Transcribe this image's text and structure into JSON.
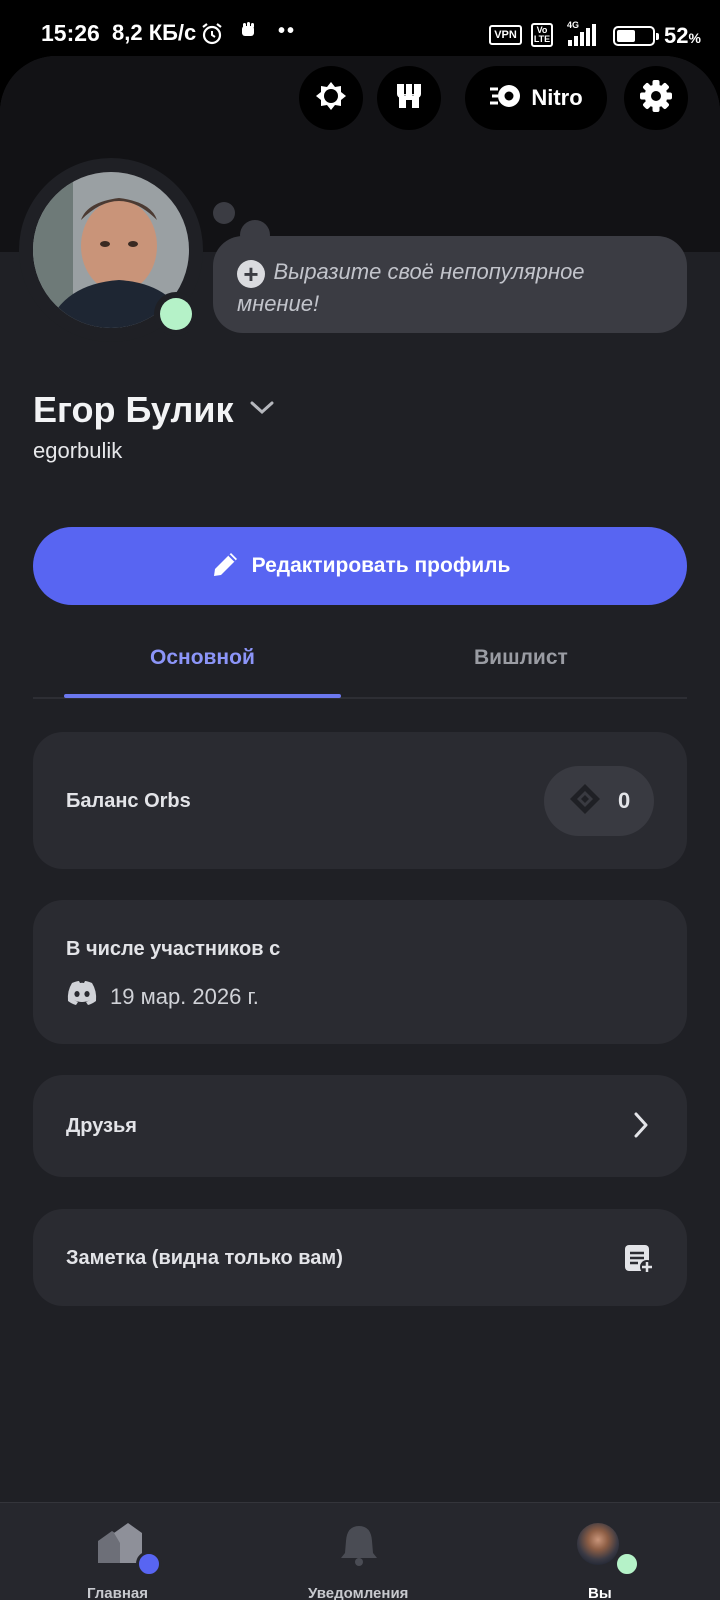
{
  "status_bar": {
    "time": "15:26",
    "speed": "8,2 КБ/с",
    "extra_dots": "••",
    "vpn": "VPN",
    "volte_top": "Vo",
    "volte_bottom": "LTE",
    "network": "4G",
    "battery_value": "52",
    "battery_unit": "%",
    "battery_level": 0.52
  },
  "header": {
    "nitro_label": "Nitro",
    "icons": [
      "quests-icon",
      "shop-icon",
      "nitro-icon",
      "settings-icon"
    ]
  },
  "profile": {
    "display_name": "Егор Булик",
    "username": "egorbulik",
    "status_color": "#b5f2c8",
    "bubble_placeholder": "Выразите своё непопулярное мнение!"
  },
  "edit_button": {
    "label": "Редактировать профиль"
  },
  "tabs": [
    {
      "label": "Основной",
      "active": true
    },
    {
      "label": "Вишлист",
      "active": false
    }
  ],
  "orbs": {
    "label": "Баланс Orbs",
    "value": "0"
  },
  "member_since": {
    "label": "В числе участников с",
    "date": "19 мар. 2026 г."
  },
  "friends": {
    "label": "Друзья"
  },
  "note": {
    "label": "Заметка (видна только вам)"
  },
  "bottom_nav": [
    {
      "label": "Главная",
      "active": false
    },
    {
      "label": "Уведомления",
      "active": false
    },
    {
      "label": "Вы",
      "active": true
    }
  ],
  "colors": {
    "accent": "#5865f2",
    "tab_active": "#8c95f8",
    "online": "#b5f2c8",
    "background": "#1f2025",
    "card": "#2a2b31"
  }
}
